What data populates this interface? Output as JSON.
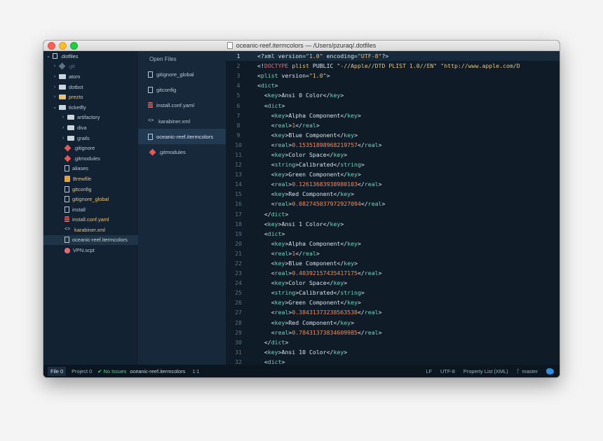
{
  "window": {
    "title": "oceanic-reef.itermcolors — /Users/pzuraq/.dotfiles"
  },
  "tree": {
    "items": [
      {
        "label": ".dotfiles",
        "chev": "⌄",
        "icon": "repo",
        "indent": 3,
        "color": "#c8d4de"
      },
      {
        "label": ".git",
        "chev": "›",
        "icon": "diamond",
        "indent": 12,
        "color": "#5f7283",
        "iconColor": "#5f7283"
      },
      {
        "label": "atom",
        "chev": "›",
        "icon": "folder",
        "indent": 12,
        "color": "#b8c7d4"
      },
      {
        "label": "dotbot",
        "chev": "›",
        "icon": "folder",
        "indent": 12,
        "color": "#b8c7d4"
      },
      {
        "label": "prezto",
        "chev": "›",
        "icon": "folder-yellow",
        "indent": 12,
        "color": "#e5c07b"
      },
      {
        "label": "ticketfly",
        "chev": "⌄",
        "icon": "folder",
        "indent": 12,
        "color": "#b8c7d4"
      },
      {
        "label": "artifactory",
        "chev": "›",
        "icon": "folder",
        "indent": 24,
        "color": "#b8c7d4"
      },
      {
        "label": "diva",
        "chev": "›",
        "icon": "folder",
        "indent": 24,
        "color": "#b8c7d4"
      },
      {
        "label": "grails",
        "chev": "›",
        "icon": "folder",
        "indent": 24,
        "color": "#b8c7d4"
      },
      {
        "label": ".gitignore",
        "chev": "",
        "icon": "diamond",
        "indent": 20,
        "color": "#b8c7d4",
        "iconColor": "#e05a5a"
      },
      {
        "label": ".gitmodules",
        "chev": "",
        "icon": "diamond",
        "indent": 20,
        "color": "#b8c7d4",
        "iconColor": "#e05a5a"
      },
      {
        "label": "aliases",
        "chev": "",
        "icon": "file",
        "indent": 20,
        "color": "#b8c7d4"
      },
      {
        "label": "Brewfile",
        "chev": "",
        "icon": "brew",
        "indent": 20,
        "color": "#e5c07b"
      },
      {
        "label": "gitconfig",
        "chev": "",
        "icon": "file",
        "indent": 20,
        "color": "#e5c07b"
      },
      {
        "label": "gitignore_global",
        "chev": "",
        "icon": "file",
        "indent": 20,
        "color": "#e5c07b"
      },
      {
        "label": "install",
        "chev": "",
        "icon": "file",
        "indent": 20,
        "color": "#b8c7d4"
      },
      {
        "label": "install.conf.yaml",
        "chev": "",
        "icon": "db",
        "indent": 20,
        "color": "#e5c07b"
      },
      {
        "label": "karabiner.xml",
        "chev": "",
        "icon": "code",
        "indent": 20,
        "color": "#e5c07b"
      },
      {
        "label": "oceanic-reef.itermcolors",
        "chev": "",
        "icon": "file",
        "indent": 20,
        "color": "#c8d4de",
        "selected": true
      },
      {
        "label": "VPN.scpt",
        "chev": "",
        "icon": "apple",
        "indent": 20,
        "color": "#b8c7d4"
      }
    ]
  },
  "open_files": {
    "header": "Open Files",
    "items": [
      {
        "label": "gitignore_global",
        "icon": "file"
      },
      {
        "label": "gitconfig",
        "icon": "file"
      },
      {
        "label": "install.conf.yaml",
        "icon": "db"
      },
      {
        "label": "karabiner.xml",
        "icon": "code"
      },
      {
        "label": "oceanic-reef.itermcolors",
        "icon": "file",
        "active": true
      },
      {
        "label": ".gitmodules",
        "icon": "diamond"
      }
    ]
  },
  "editor": {
    "current_line": 1,
    "colors": {
      "text": "#d7e3ec",
      "tag": "#6fd3b8",
      "string": "#e5c07b",
      "number": "#f08a5d",
      "keyword": "#e06c75",
      "plain": "#d7e3ec"
    },
    "lines": [
      [
        [
          "plain",
          "<?xml version="
        ],
        [
          "string",
          "\"1.0\""
        ],
        [
          "plain",
          " encoding="
        ],
        [
          "string",
          "\"UTF-8\""
        ],
        [
          "plain",
          "?>"
        ]
      ],
      [
        [
          "plain",
          "<!"
        ],
        [
          "keyword",
          "DOCTYPE"
        ],
        [
          "plain",
          " "
        ],
        [
          "string",
          "plist"
        ],
        [
          "plain",
          " PUBLIC "
        ],
        [
          "string",
          "\"-//Apple//DTD PLIST 1.0//EN\""
        ],
        [
          "plain",
          " "
        ],
        [
          "string",
          "\"http://www.apple.com/D"
        ]
      ],
      [
        [
          "plain",
          "<"
        ],
        [
          "tag",
          "plist"
        ],
        [
          "plain",
          " version="
        ],
        [
          "string",
          "\"1.0\""
        ],
        [
          "plain",
          ">"
        ]
      ],
      [
        [
          "plain",
          "<"
        ],
        [
          "tag",
          "dict"
        ],
        [
          "plain",
          ">"
        ]
      ],
      [
        [
          "plain",
          "  <"
        ],
        [
          "tag",
          "key"
        ],
        [
          "plain",
          ">Ansi 0 Color</"
        ],
        [
          "tag",
          "key"
        ],
        [
          "plain",
          ">"
        ]
      ],
      [
        [
          "plain",
          "  <"
        ],
        [
          "tag",
          "dict"
        ],
        [
          "plain",
          ">"
        ]
      ],
      [
        [
          "plain",
          "    <"
        ],
        [
          "tag",
          "key"
        ],
        [
          "plain",
          ">Alpha Component</"
        ],
        [
          "tag",
          "key"
        ],
        [
          "plain",
          ">"
        ]
      ],
      [
        [
          "plain",
          "    <"
        ],
        [
          "tag",
          "real"
        ],
        [
          "plain",
          ">"
        ],
        [
          "number",
          "1"
        ],
        [
          "plain",
          "</"
        ],
        [
          "tag",
          "real"
        ],
        [
          "plain",
          ">"
        ]
      ],
      [
        [
          "plain",
          "    <"
        ],
        [
          "tag",
          "key"
        ],
        [
          "plain",
          ">Blue Component</"
        ],
        [
          "tag",
          "key"
        ],
        [
          "plain",
          ">"
        ]
      ],
      [
        [
          "plain",
          "    <"
        ],
        [
          "tag",
          "real"
        ],
        [
          "plain",
          ">"
        ],
        [
          "number",
          "0.15351898968219757"
        ],
        [
          "plain",
          "</"
        ],
        [
          "tag",
          "real"
        ],
        [
          "plain",
          ">"
        ]
      ],
      [
        [
          "plain",
          "    <"
        ],
        [
          "tag",
          "key"
        ],
        [
          "plain",
          ">Color Space</"
        ],
        [
          "tag",
          "key"
        ],
        [
          "plain",
          ">"
        ]
      ],
      [
        [
          "plain",
          "    <"
        ],
        [
          "tag",
          "string"
        ],
        [
          "plain",
          ">Calibrated</"
        ],
        [
          "tag",
          "string"
        ],
        [
          "plain",
          ">"
        ]
      ],
      [
        [
          "plain",
          "    <"
        ],
        [
          "tag",
          "key"
        ],
        [
          "plain",
          ">Green Component</"
        ],
        [
          "tag",
          "key"
        ],
        [
          "plain",
          ">"
        ]
      ],
      [
        [
          "plain",
          "    <"
        ],
        [
          "tag",
          "real"
        ],
        [
          "plain",
          ">"
        ],
        [
          "number",
          "0.12613683938980103"
        ],
        [
          "plain",
          "</"
        ],
        [
          "tag",
          "real"
        ],
        [
          "plain",
          ">"
        ]
      ],
      [
        [
          "plain",
          "    <"
        ],
        [
          "tag",
          "key"
        ],
        [
          "plain",
          ">Red Component</"
        ],
        [
          "tag",
          "key"
        ],
        [
          "plain",
          ">"
        ]
      ],
      [
        [
          "plain",
          "    <"
        ],
        [
          "tag",
          "real"
        ],
        [
          "plain",
          ">"
        ],
        [
          "number",
          "0.082745037972927094"
        ],
        [
          "plain",
          "</"
        ],
        [
          "tag",
          "real"
        ],
        [
          "plain",
          ">"
        ]
      ],
      [
        [
          "plain",
          "  </"
        ],
        [
          "tag",
          "dict"
        ],
        [
          "plain",
          ">"
        ]
      ],
      [
        [
          "plain",
          "  <"
        ],
        [
          "tag",
          "key"
        ],
        [
          "plain",
          ">Ansi 1 Color</"
        ],
        [
          "tag",
          "key"
        ],
        [
          "plain",
          ">"
        ]
      ],
      [
        [
          "plain",
          "  <"
        ],
        [
          "tag",
          "dict"
        ],
        [
          "plain",
          ">"
        ]
      ],
      [
        [
          "plain",
          "    <"
        ],
        [
          "tag",
          "key"
        ],
        [
          "plain",
          ">Alpha Component</"
        ],
        [
          "tag",
          "key"
        ],
        [
          "plain",
          ">"
        ]
      ],
      [
        [
          "plain",
          "    <"
        ],
        [
          "tag",
          "real"
        ],
        [
          "plain",
          ">"
        ],
        [
          "number",
          "1"
        ],
        [
          "plain",
          "</"
        ],
        [
          "tag",
          "real"
        ],
        [
          "plain",
          ">"
        ]
      ],
      [
        [
          "plain",
          "    <"
        ],
        [
          "tag",
          "key"
        ],
        [
          "plain",
          ">Blue Component</"
        ],
        [
          "tag",
          "key"
        ],
        [
          "plain",
          ">"
        ]
      ],
      [
        [
          "plain",
          "    <"
        ],
        [
          "tag",
          "real"
        ],
        [
          "plain",
          ">"
        ],
        [
          "number",
          "0.40392157435417175"
        ],
        [
          "plain",
          "</"
        ],
        [
          "tag",
          "real"
        ],
        [
          "plain",
          ">"
        ]
      ],
      [
        [
          "plain",
          "    <"
        ],
        [
          "tag",
          "key"
        ],
        [
          "plain",
          ">Color Space</"
        ],
        [
          "tag",
          "key"
        ],
        [
          "plain",
          ">"
        ]
      ],
      [
        [
          "plain",
          "    <"
        ],
        [
          "tag",
          "string"
        ],
        [
          "plain",
          ">Calibrated</"
        ],
        [
          "tag",
          "string"
        ],
        [
          "plain",
          ">"
        ]
      ],
      [
        [
          "plain",
          "    <"
        ],
        [
          "tag",
          "key"
        ],
        [
          "plain",
          ">Green Component</"
        ],
        [
          "tag",
          "key"
        ],
        [
          "plain",
          ">"
        ]
      ],
      [
        [
          "plain",
          "    <"
        ],
        [
          "tag",
          "real"
        ],
        [
          "plain",
          ">"
        ],
        [
          "number",
          "0.38431373238563538"
        ],
        [
          "plain",
          "</"
        ],
        [
          "tag",
          "real"
        ],
        [
          "plain",
          ">"
        ]
      ],
      [
        [
          "plain",
          "    <"
        ],
        [
          "tag",
          "key"
        ],
        [
          "plain",
          ">Red Component</"
        ],
        [
          "tag",
          "key"
        ],
        [
          "plain",
          ">"
        ]
      ],
      [
        [
          "plain",
          "    <"
        ],
        [
          "tag",
          "real"
        ],
        [
          "plain",
          ">"
        ],
        [
          "number",
          "0.78431373834609985"
        ],
        [
          "plain",
          "</"
        ],
        [
          "tag",
          "real"
        ],
        [
          "plain",
          ">"
        ]
      ],
      [
        [
          "plain",
          "  </"
        ],
        [
          "tag",
          "dict"
        ],
        [
          "plain",
          ">"
        ]
      ],
      [
        [
          "plain",
          "  <"
        ],
        [
          "tag",
          "key"
        ],
        [
          "plain",
          ">Ansi 10 Color</"
        ],
        [
          "tag",
          "key"
        ],
        [
          "plain",
          ">"
        ]
      ],
      [
        [
          "plain",
          "  <"
        ],
        [
          "tag",
          "dict"
        ],
        [
          "plain",
          ">"
        ]
      ]
    ]
  },
  "statusbar": {
    "file_tab": "File 0",
    "project_tab": "Project 0",
    "no_issues": "✔ No Issues",
    "filename": "oceanic-reef.itermcolors",
    "cursor": "1:1",
    "line_ending": "LF",
    "encoding": "UTF-8",
    "grammar": "Property List (XML)",
    "branch": "master"
  }
}
